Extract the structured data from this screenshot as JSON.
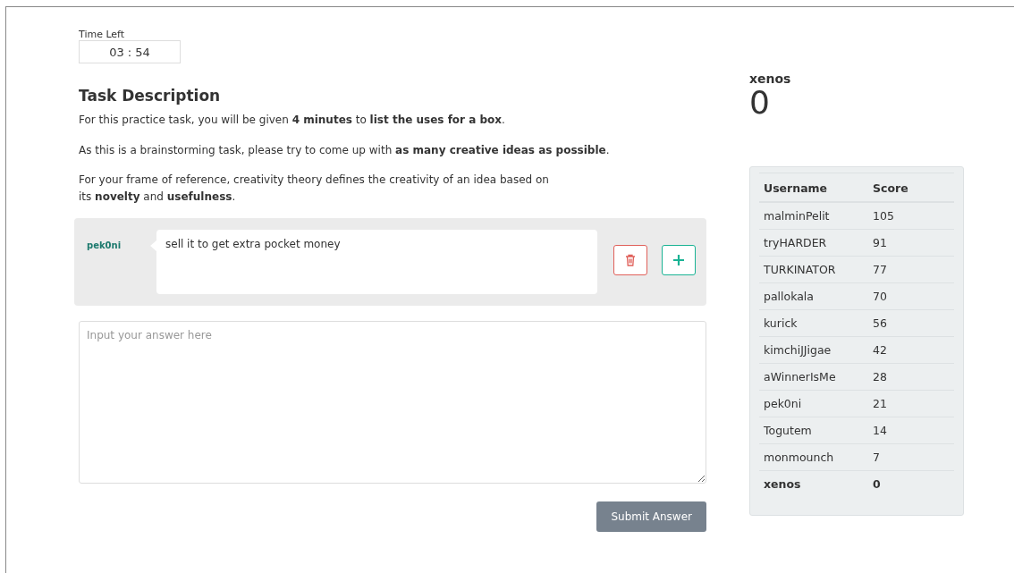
{
  "timer": {
    "label": "Time Left",
    "value": "03 : 54"
  },
  "task": {
    "title": "Task Description",
    "paragraphs": [
      "For this practice task, you will be given **4 minutes** to **list the uses for a box**.",
      "As this is a brainstorming task, please try to come up with **as many creative ideas as possible**.",
      "For your frame of reference, creativity theory defines the creativity of an idea based on\nits **novelty** and **usefulness**."
    ]
  },
  "ideas": [
    {
      "author": "pek0ni",
      "text": "sell it to get extra pocket money"
    }
  ],
  "answer": {
    "placeholder": "Input your answer here"
  },
  "submit_button": "Submit Answer",
  "player": {
    "name": "xenos",
    "score": "0"
  },
  "leaderboard": {
    "columns": [
      "Username",
      "Score"
    ],
    "rows": [
      {
        "username": "malminPelit",
        "score": "105",
        "current": false
      },
      {
        "username": "tryHARDER",
        "score": "91",
        "current": false
      },
      {
        "username": "TURKINATOR",
        "score": "77",
        "current": false
      },
      {
        "username": "pallokala",
        "score": "70",
        "current": false
      },
      {
        "username": "kurick",
        "score": "56",
        "current": false
      },
      {
        "username": "kimchiJJigae",
        "score": "42",
        "current": false
      },
      {
        "username": "aWinnerIsMe",
        "score": "28",
        "current": false
      },
      {
        "username": "pek0ni",
        "score": "21",
        "current": false
      },
      {
        "username": "Togutem",
        "score": "14",
        "current": false
      },
      {
        "username": "monmounch",
        "score": "7",
        "current": false
      },
      {
        "username": "xenos",
        "score": "0",
        "current": true
      }
    ]
  }
}
